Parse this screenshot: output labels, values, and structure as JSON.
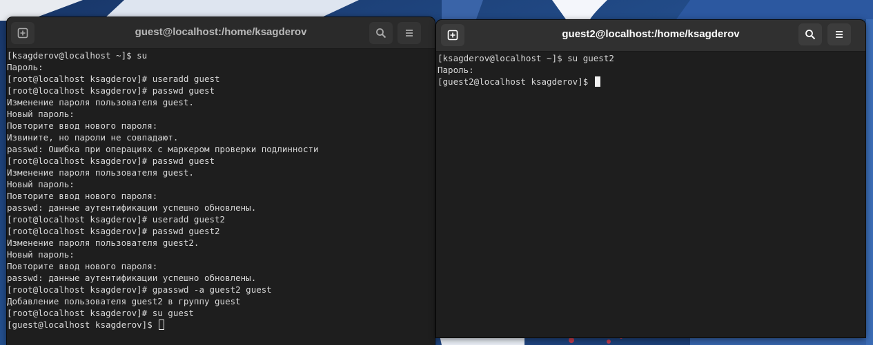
{
  "colors": {
    "desktop": "#1f3f73",
    "terminal_bg": "#1e1e1e",
    "titlebar_active": "#303030",
    "titlebar_inactive": "#2a2a2a",
    "text": "#d8d8d8"
  },
  "left_window": {
    "title": "guest@localhost:/home/ksagderov",
    "new_tab_icon": "new-tab-icon",
    "search_icon": "search-icon",
    "menu_icon": "hamburger-menu-icon",
    "focused": false,
    "lines": [
      "[ksagderov@localhost ~]$ su",
      "Пароль:",
      "[root@localhost ksagderov]# useradd guest",
      "[root@localhost ksagderov]# passwd guest",
      "Изменение пароля пользователя guest.",
      "Новый пароль:",
      "Повторите ввод нового пароля:",
      "Извините, но пароли не совпадают.",
      "passwd: Ошибка при операциях с маркером проверки подлинности",
      "[root@localhost ksagderov]# passwd guest",
      "Изменение пароля пользователя guest.",
      "Новый пароль:",
      "Повторите ввод нового пароля:",
      "passwd: данные аутентификации успешно обновлены.",
      "[root@localhost ksagderov]# useradd guest2",
      "[root@localhost ksagderov]# passwd guest2",
      "Изменение пароля пользователя guest2.",
      "Новый пароль:",
      "Повторите ввод нового пароля:",
      "passwd: данные аутентификации успешно обновлены.",
      "[root@localhost ksagderov]# gpasswd -a guest2 guest",
      "Добавление пользователя guest2 в группу guest",
      "[root@localhost ksagderov]# su guest"
    ],
    "prompt": "[guest@localhost ksagderov]$ "
  },
  "right_window": {
    "title": "guest2@localhost:/home/ksagderov",
    "new_tab_icon": "new-tab-icon",
    "search_icon": "search-icon",
    "menu_icon": "hamburger-menu-icon",
    "focused": true,
    "lines": [
      "[ksagderov@localhost ~]$ su guest2",
      "Пароль:"
    ],
    "prompt": "[guest2@localhost ksagderov]$ "
  }
}
